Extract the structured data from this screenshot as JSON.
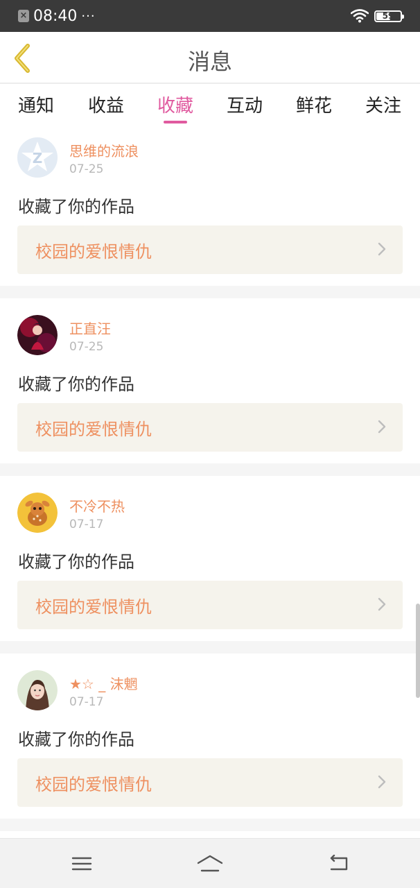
{
  "status_bar": {
    "time": "08:40",
    "dots": "···",
    "battery": "59",
    "battery_level": 0.59
  },
  "header": {
    "title": "消息",
    "back_icon": "chevron-left-icon"
  },
  "tabs": [
    {
      "label": "通知",
      "active": false
    },
    {
      "label": "收益",
      "active": false
    },
    {
      "label": "收藏",
      "active": true
    },
    {
      "label": "互动",
      "active": false
    },
    {
      "label": "鲜花",
      "active": false
    },
    {
      "label": "关注",
      "active": false
    }
  ],
  "colors": {
    "accent_tab": "#e05a9f",
    "username": "#ee9060",
    "work_title": "#ee9060",
    "back_arrow": "#d8b830"
  },
  "items": [
    {
      "username": "思维的流浪",
      "date": "07-25",
      "action": "收藏了你的作品",
      "work_title": "校园的爱恨情仇",
      "avatar": "qzone-star-avatar"
    },
    {
      "username": "正直汪",
      "date": "07-25",
      "action": "收藏了你的作品",
      "work_title": "校园的爱恨情仇",
      "avatar": "anime-figure-avatar"
    },
    {
      "username": "不冷不热",
      "date": "07-17",
      "action": "收藏了你的作品",
      "work_title": "校园的爱恨情仇",
      "avatar": "fawn-avatar"
    },
    {
      "username": "★☆ _ 沫魍",
      "date": "07-17",
      "action": "收藏了你的作品",
      "work_title": "校园的爱恨情仇",
      "avatar": "girl-photo-avatar"
    }
  ],
  "bottom_nav": [
    "menu-icon",
    "home-icon",
    "back-icon"
  ]
}
